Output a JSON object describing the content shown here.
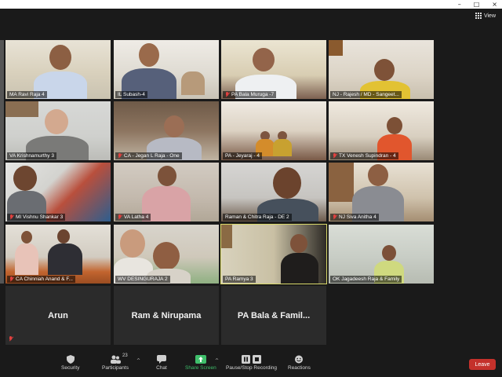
{
  "window": {
    "controls": [
      "–",
      "□",
      "×"
    ]
  },
  "view_button": {
    "label": "View"
  },
  "participants": [
    {
      "name": "MA Ravi Raja 4",
      "muted": false
    },
    {
      "name": "IL Subash-4",
      "muted": false
    },
    {
      "name": "PA Bala Muruga -7",
      "muted": true
    },
    {
      "name": "NJ - Rajesh / MD - Sangeet...",
      "muted": false
    },
    {
      "name": "VA Krishnamurthy 3",
      "muted": false
    },
    {
      "name": "CA - Jegan L Raja - One",
      "muted": true
    },
    {
      "name": "PA - Jeyaraj - 4",
      "muted": false
    },
    {
      "name": "TX Venesh Supindran - 4",
      "muted": true
    },
    {
      "name": "MI Vishnu Shankar 3",
      "muted": true
    },
    {
      "name": "VA Latha 4",
      "muted": true
    },
    {
      "name": "Raman & Chitra Raja - DE 2",
      "muted": false
    },
    {
      "name": "NJ Siva Anitha 4",
      "muted": true
    },
    {
      "name": "CA Chinniah Anand & F...",
      "muted": true
    },
    {
      "name": "WV DESINGURAJA 2",
      "muted": false
    },
    {
      "name": "PA Ramya 3",
      "muted": false
    },
    {
      "name": "OK Jagadeesh Raja & Family",
      "muted": false
    }
  ],
  "name_tiles": [
    {
      "name": "Arun",
      "muted": true
    },
    {
      "name": "Ram & Nirupama",
      "muted": false
    },
    {
      "name": "PA Bala & Famil...",
      "muted": false
    }
  ],
  "toolbar": {
    "security": "Security",
    "participants": "Participants",
    "participants_count": "23",
    "chat": "Chat",
    "share_screen": "Share Screen",
    "recording": "Pause/Stop Recording",
    "reactions": "Reactions",
    "leave": "Leave"
  },
  "colors": {
    "accent_green": "#3fbf6b",
    "leave_red": "#c4312b",
    "active_speaker": "#d8d86a"
  }
}
